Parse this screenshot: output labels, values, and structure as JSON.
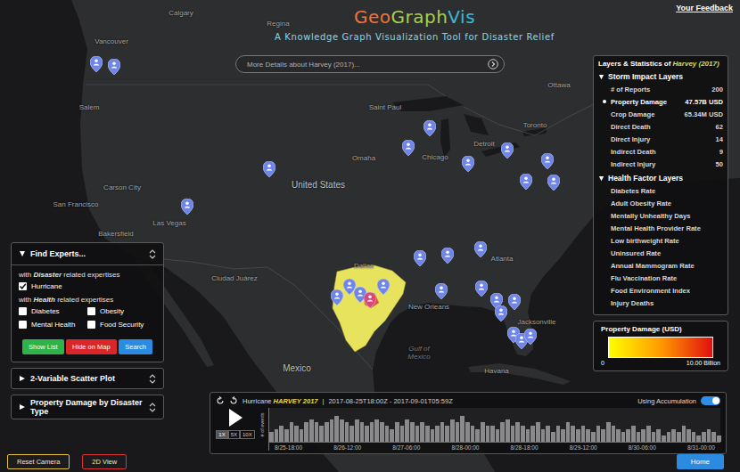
{
  "header": {
    "feedback": "Your Feedback",
    "title": [
      {
        "text": "Geo",
        "color": "#f0743a"
      },
      {
        "text": "Graph",
        "color": "#a6d04a"
      },
      {
        "text": "Vis",
        "color": "#3fb7d9"
      }
    ],
    "subtitle": "A Knowledge Graph Visualization Tool for Disaster Relief",
    "details": "More Details about Harvey (2017)..."
  },
  "map": {
    "labels": [
      {
        "text": "Calgary",
        "kind": "city"
      },
      {
        "text": "Regina",
        "kind": "city"
      },
      {
        "text": "Vancouver",
        "kind": "city"
      },
      {
        "text": "Salem",
        "kind": "city"
      },
      {
        "text": "Saint Paul",
        "kind": "city"
      },
      {
        "text": "Ottawa",
        "kind": "city"
      },
      {
        "text": "Toronto",
        "kind": "city"
      },
      {
        "text": "Detroit",
        "kind": "city"
      },
      {
        "text": "Chicago",
        "kind": "city"
      },
      {
        "text": "Omaha",
        "kind": "city"
      },
      {
        "text": "Carson City",
        "kind": "city"
      },
      {
        "text": "San Francisco",
        "kind": "city"
      },
      {
        "text": "United States",
        "kind": "country"
      },
      {
        "text": "Las Vegas",
        "kind": "city"
      },
      {
        "text": "Bakersfield",
        "kind": "city"
      },
      {
        "text": "Dallas",
        "kind": "city"
      },
      {
        "text": "Ciudad Juárez",
        "kind": "city"
      },
      {
        "text": "Atlanta",
        "kind": "city"
      },
      {
        "text": "New Orleans",
        "kind": "city"
      },
      {
        "text": "Jacksonville",
        "kind": "city"
      },
      {
        "text": "Gulf of Mexico",
        "kind": "water"
      },
      {
        "text": "Mexico",
        "kind": "country"
      },
      {
        "text": "Havana",
        "kind": "city"
      }
    ],
    "pins": [
      {
        "selected": false
      },
      {
        "selected": false
      },
      {
        "selected": false
      },
      {
        "selected": false
      },
      {
        "selected": false
      },
      {
        "selected": false
      },
      {
        "selected": false
      },
      {
        "selected": false
      },
      {
        "selected": false
      },
      {
        "selected": false
      },
      {
        "selected": false
      },
      {
        "selected": false
      },
      {
        "selected": false
      },
      {
        "selected": false
      },
      {
        "selected": false
      },
      {
        "selected": false
      },
      {
        "selected": false
      },
      {
        "selected": false
      },
      {
        "selected": false
      },
      {
        "selected": false
      },
      {
        "selected": false
      },
      {
        "selected": false
      },
      {
        "selected": false
      },
      {
        "selected": false
      },
      {
        "selected": false
      },
      {
        "selected": true
      },
      {
        "selected": false
      }
    ],
    "affected_counties": [
      {
        "color": "#e8e35c"
      },
      {
        "color": "#e2483d"
      }
    ]
  },
  "find_experts": {
    "title": "Find Experts...",
    "expanded": true,
    "disaster_heading": {
      "pre": "with ",
      "emph": "Disaster",
      "post": " related expertises"
    },
    "disaster_options": [
      {
        "label": "Hurricane",
        "checked": true
      }
    ],
    "health_heading": {
      "pre": "with ",
      "emph": "Health",
      "post": " related expertises"
    },
    "health_options": [
      {
        "label": "Diabetes",
        "checked": false
      },
      {
        "label": "Obesity",
        "checked": false
      },
      {
        "label": "Mental Health",
        "checked": false
      },
      {
        "label": "Food Security",
        "checked": false
      }
    ],
    "buttons": [
      {
        "label": "Show List",
        "color": "#2db34a"
      },
      {
        "label": "Hide on Map",
        "color": "#d9262b"
      },
      {
        "label": "Search",
        "color": "#2a8be0"
      }
    ]
  },
  "collapsed_sections": [
    {
      "title": "2-Variable Scatter Plot",
      "expanded": false
    },
    {
      "title": "Property Damage by Disaster Type",
      "expanded": false
    }
  ],
  "layers": {
    "title_pre": "Layers & Statistics of ",
    "title_event": "Harvey (2017)",
    "storm": {
      "title": "Storm Impact Layers",
      "expanded": true,
      "rows": [
        {
          "label": "# of Reports",
          "value": "200",
          "selected": false
        },
        {
          "label": "Property Damage",
          "value": "47.57B USD",
          "selected": true
        },
        {
          "label": "Crop Damage",
          "value": "65.34M USD",
          "selected": false
        },
        {
          "label": "Direct Death",
          "value": "62",
          "selected": false
        },
        {
          "label": "Direct Injury",
          "value": "14",
          "selected": false
        },
        {
          "label": "Indirect Death",
          "value": "9",
          "selected": false
        },
        {
          "label": "Indirect Injury",
          "value": "50",
          "selected": false
        }
      ]
    },
    "health": {
      "title": "Health Factor Layers",
      "expanded": true,
      "rows": [
        {
          "label": "Diabetes Rate",
          "selected": false
        },
        {
          "label": "Adult Obesity Rate",
          "selected": false
        },
        {
          "label": "Mentally Unhealthy Days",
          "selected": false
        },
        {
          "label": "Mental Health Provider Rate",
          "selected": false
        },
        {
          "label": "Low birthweight Rate",
          "selected": false
        },
        {
          "label": "Uninsured Rate",
          "selected": false
        },
        {
          "label": "Annual Mammogram Rate",
          "selected": false
        },
        {
          "label": "Flu Vaccination Rate",
          "selected": false
        },
        {
          "label": "Food Environment Index",
          "selected": false
        },
        {
          "label": "Injury Deaths",
          "selected": false
        }
      ]
    }
  },
  "legend": {
    "title": "Property Damage (USD)",
    "min": "0",
    "max": "10.00 Billion"
  },
  "timeline": {
    "prefix": "Hurricane ",
    "name": "HARVEY 2017",
    "separator": "|",
    "range": "2017-08-25T18:00Z - 2017-09-01T05:59Z",
    "accumulation": {
      "label": "Using Accumulation",
      "on": true
    },
    "speeds": [
      {
        "label": "1X",
        "selected": true
      },
      {
        "label": "5X",
        "selected": false
      },
      {
        "label": "10X",
        "selected": false
      }
    ],
    "axis_label": "# of events",
    "axis_max": 10,
    "values": [
      3,
      4,
      5,
      4,
      6,
      5,
      4,
      6,
      7,
      6,
      5,
      6,
      7,
      8,
      7,
      6,
      5,
      7,
      6,
      5,
      6,
      7,
      6,
      5,
      4,
      6,
      5,
      7,
      6,
      5,
      6,
      5,
      4,
      5,
      6,
      5,
      7,
      6,
      8,
      6,
      5,
      4,
      6,
      5,
      5,
      4,
      6,
      7,
      5,
      6,
      5,
      4,
      5,
      6,
      4,
      5,
      3,
      5,
      4,
      6,
      5,
      4,
      5,
      4,
      3,
      5,
      4,
      6,
      5,
      4,
      3,
      4,
      5,
      3,
      4,
      5,
      3,
      4,
      2,
      3,
      4,
      3,
      5,
      4,
      3,
      2,
      3,
      4,
      3,
      2
    ],
    "ticks": [
      "8/25-18:00",
      "8/26-12:00",
      "8/27-06:00",
      "8/28-00:00",
      "8/28-18:00",
      "8/29-12:00",
      "8/30-06:00",
      "8/31-00:00"
    ]
  },
  "footer": {
    "buttons": [
      {
        "label": "Reset Camera",
        "color": "#e3c13b"
      },
      {
        "label": "2D View",
        "color": "#d8343a"
      }
    ],
    "home": "Home"
  }
}
